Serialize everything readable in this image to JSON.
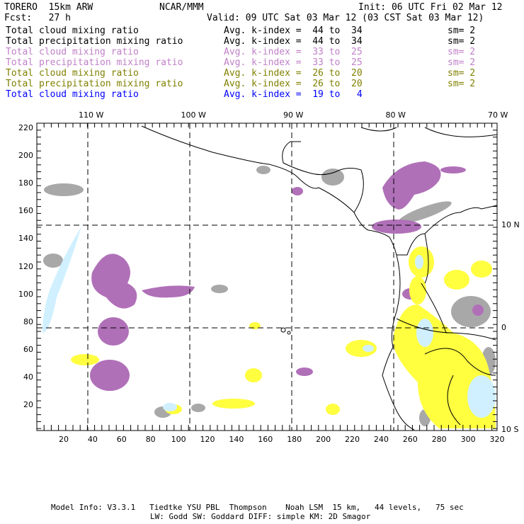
{
  "header": {
    "model": "TORERO  15km ARW",
    "org": "NCAR/MMM",
    "init": "Init: 06 UTC Fri 02 Mar 12",
    "fcst": "Fcst:   27 h",
    "valid": "Valid: 09 UTC Sat 03 Mar 12 (03 CST Sat 03 Mar 12)"
  },
  "legend": [
    {
      "field": "Total cloud mixing ratio",
      "range": "Avg. k-index =  44 to  34",
      "sm": "sm= 2",
      "color": "#000000"
    },
    {
      "field": "Total precipitation mixing ratio",
      "range": "Avg. k-index =  44 to  34",
      "sm": "sm= 2",
      "color": "#000000"
    },
    {
      "field": "Total cloud mixing ratio",
      "range": "Avg. k-index =  33 to  25",
      "sm": "sm= 2",
      "color": "#c080c8"
    },
    {
      "field": "Total precipitation mixing ratio",
      "range": "Avg. k-index =  33 to  25",
      "sm": "sm= 2",
      "color": "#c080c8"
    },
    {
      "field": "Total cloud mixing ratio",
      "range": "Avg. k-index =  26 to  20",
      "sm": "sm= 2",
      "color": "#808000"
    },
    {
      "field": "Total precipitation mixing ratio",
      "range": "Avg. k-index =  26 to  20",
      "sm": "sm= 2",
      "color": "#808000"
    },
    {
      "field": "Total cloud mixing ratio",
      "range": "Avg. k-index =  19 to   4",
      "sm": "",
      "color": "#0000ff"
    }
  ],
  "axes": {
    "top": [
      "110 W",
      "100 W",
      "90 W",
      "80 W",
      "70 W"
    ],
    "right": [
      "10 N",
      "0",
      "10 S"
    ],
    "left": [
      "220",
      "200",
      "180",
      "160",
      "140",
      "120",
      "100",
      "80",
      "60",
      "40",
      "20"
    ],
    "bottom": [
      "20",
      "40",
      "60",
      "80",
      "100",
      "120",
      "140",
      "160",
      "180",
      "200",
      "220",
      "240",
      "260",
      "280",
      "300",
      "320"
    ]
  },
  "footer": {
    "line1": "Model Info: V3.3.1   Tiedtke YSU PBL  Thompson    Noah LSM  15 km,   44 levels,   75 sec",
    "line2": "LW: Godd SW: Goddard DIFF: simple KM: 2D Smagor"
  },
  "colors": {
    "purple": "#b070b8",
    "gray": "#a8a8a8",
    "yellow": "#ffff40",
    "lightblue": "#d0f0ff"
  }
}
